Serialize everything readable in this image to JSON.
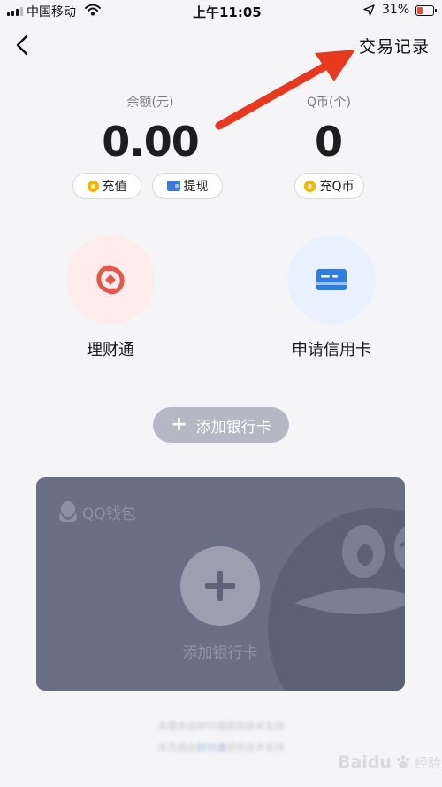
{
  "status_bar": {
    "carrier": "中国移动",
    "time": "上午11:05",
    "battery": "31%",
    "battery_level": 0.31,
    "icons": [
      "signal-icon",
      "wifi-icon",
      "location-arrow-icon",
      "battery-icon"
    ]
  },
  "nav": {
    "back_icon": "chevron-left-icon",
    "transaction_record": "交易记录"
  },
  "balance": {
    "label": "余额(元)",
    "value": "0.00",
    "recharge": "充值",
    "withdraw": "提现"
  },
  "qcoin": {
    "label": "Q币(个)",
    "value": "0",
    "recharge": "充Q币"
  },
  "features": [
    {
      "label": "理财通",
      "icon": "licaitong-icon"
    },
    {
      "label": "申请信用卡",
      "icon": "credit-card-icon"
    }
  ],
  "add_card_button": "添加银行卡",
  "card": {
    "brand": "QQ钱包",
    "add_label": "添加银行卡"
  },
  "footer": {
    "line1": "本服务由财付通提供技术支持",
    "line2_pre": "本页面由",
    "line2_link": "财付通",
    "line2_post": "提供技术支持"
  },
  "watermark": {
    "text": "Baidu",
    "suffix": "经验"
  },
  "colors": {
    "annotation_arrow": "#e8391f",
    "card_bg": "#6b6f86",
    "pill_bg": "#b5b8c4",
    "coin": "#f4b400",
    "wallet": "#3a7bd5"
  }
}
